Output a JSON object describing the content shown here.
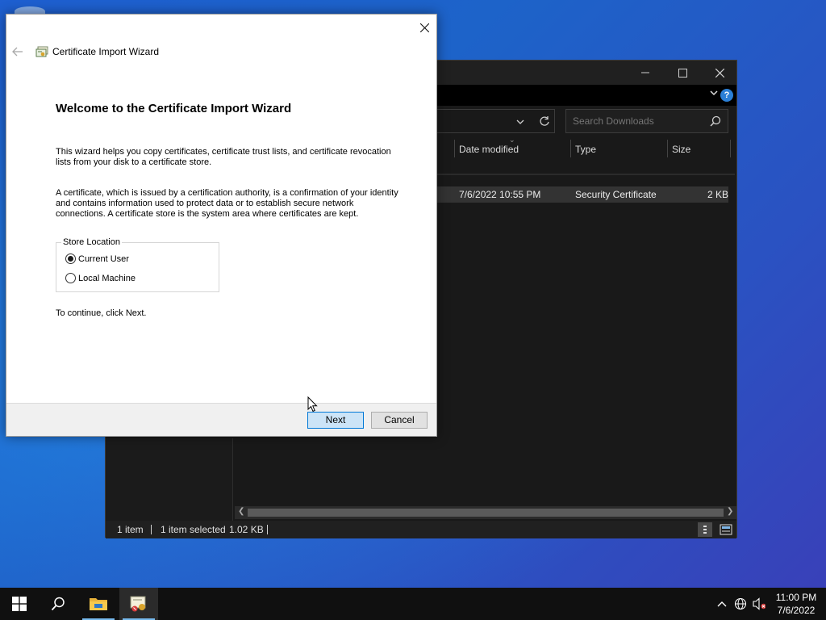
{
  "explorer": {
    "search_placeholder": "Search Downloads",
    "columns": [
      "Date modified",
      "Type",
      "Size"
    ],
    "row": {
      "date_modified": "7/6/2022 10:55 PM",
      "type": "Security Certificate",
      "size": "2 KB"
    },
    "status": {
      "item_count": "1 item",
      "selection": "1 item selected",
      "selection_size": "1.02 KB"
    },
    "help_glyph": "?"
  },
  "wizard": {
    "title": "Certificate Import Wizard",
    "heading": "Welcome to the Certificate Import Wizard",
    "intro_line1": "This wizard helps you copy certificates, certificate trust lists, and certificate revocation",
    "intro_line2": "lists from your disk to a certificate store.",
    "desc_line1": "A certificate, which is issued by a certification authority, is a confirmation of your identity",
    "desc_line2": "and contains information used to protect data or to establish secure network",
    "desc_line3": "connections. A certificate store is the system area where certificates are kept.",
    "store_location_label": "Store Location",
    "options": [
      {
        "label": "Current User",
        "selected": true
      },
      {
        "label": "Local Machine",
        "selected": false
      }
    ],
    "continue_text": "To continue, click Next.",
    "next_label": "Next",
    "cancel_label": "Cancel"
  },
  "taskbar": {
    "time": "11:00 PM",
    "date": "7/6/2022",
    "items": [
      "start-icon",
      "search-icon",
      "file-explorer-icon",
      "certificate-wizard-icon"
    ]
  },
  "colors": {
    "desktop": "#1e5fd0",
    "explorer_bg": "#191919",
    "selected_row": "#333333",
    "next_button_bg": "#cce4f7",
    "next_button_border": "#0078d7",
    "taskbar": "#101010"
  }
}
